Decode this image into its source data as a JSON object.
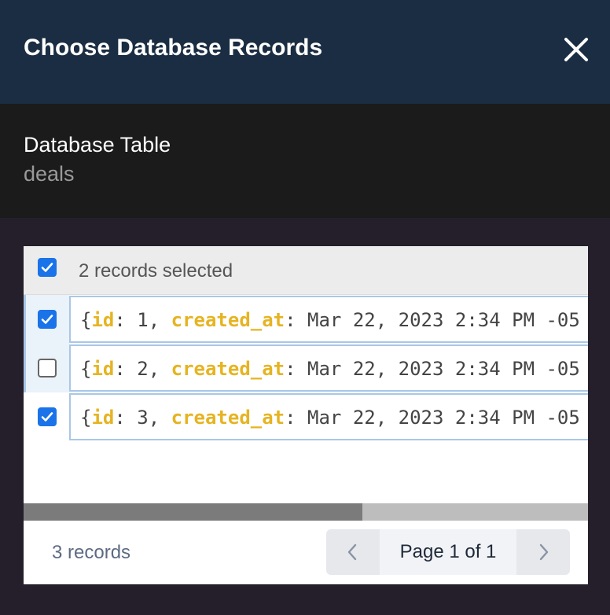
{
  "dialog": {
    "title": "Choose Database Records"
  },
  "table_info": {
    "label": "Database Table",
    "name": "deals"
  },
  "selection": {
    "summary": "2 records selected",
    "all_checked": true
  },
  "records": [
    {
      "checked": true,
      "open": "{",
      "key1": "id",
      "sep1": ": ",
      "val1": "1",
      "comma": ", ",
      "key2": "created_at",
      "sep2": ": ",
      "val2": "Mar 22, 2023 2:34 PM -05"
    },
    {
      "checked": false,
      "open": "{",
      "key1": "id",
      "sep1": ": ",
      "val1": "2",
      "comma": ", ",
      "key2": "created_at",
      "sep2": ": ",
      "val2": "Mar 22, 2023 2:34 PM -05"
    },
    {
      "checked": true,
      "open": "{",
      "key1": "id",
      "sep1": ": ",
      "val1": "3",
      "comma": ", ",
      "key2": "created_at",
      "sep2": ": ",
      "val2": "Mar 22, 2023 2:34 PM -05"
    }
  ],
  "footer": {
    "count": "3 records",
    "page_label": "Page 1 of 1"
  },
  "scroll": {
    "horizontal_thumb_fraction": 0.6
  },
  "icons": {
    "close": "close-icon",
    "check": "check-icon",
    "prev": "chevron-left-icon",
    "next": "chevron-right-icon"
  },
  "colors": {
    "header_bg": "#1b2d42",
    "key_color": "#e6b422",
    "checkbox_blue": "#1a73e8"
  }
}
